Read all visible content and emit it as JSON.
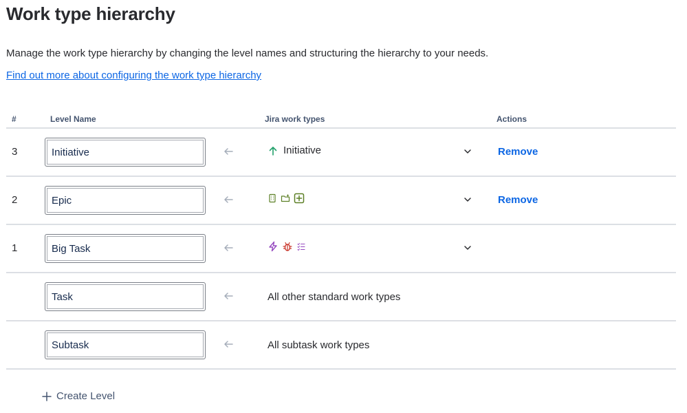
{
  "page": {
    "title": "Work type hierarchy",
    "description": "Manage the work type hierarchy by changing the level names and structuring the hierarchy to your needs.",
    "help_link": "Find out more about configuring the work type hierarchy"
  },
  "table": {
    "headers": {
      "num": "#",
      "level_name": "Level Name",
      "work_types": "Jira work types",
      "actions": "Actions"
    },
    "rows": [
      {
        "num": "3",
        "level_name": "Initiative",
        "type_icons": [
          "initiative-arrow-up-icon"
        ],
        "type_label": "Initiative",
        "remove": "Remove"
      },
      {
        "num": "2",
        "level_name": "Epic",
        "type_icons": [
          "building-icon",
          "folder-add-icon",
          "plus-square-icon"
        ],
        "remove": "Remove"
      },
      {
        "num": "1",
        "level_name": "Big Task",
        "type_icons": [
          "lightning-icon",
          "bug-icon",
          "checklist-icon"
        ]
      },
      {
        "num": "",
        "level_name": "Task",
        "types_text": "All other standard work types"
      },
      {
        "num": "",
        "level_name": "Subtask",
        "types_text": "All subtask work types"
      }
    ]
  },
  "create_level": "Create Level",
  "colors": {
    "link": "#0c66e4",
    "green": "#22a06b",
    "lime": "#5b7f24",
    "purple": "#964ac0",
    "red": "#c9372c",
    "divider": "#dcdfe4"
  }
}
